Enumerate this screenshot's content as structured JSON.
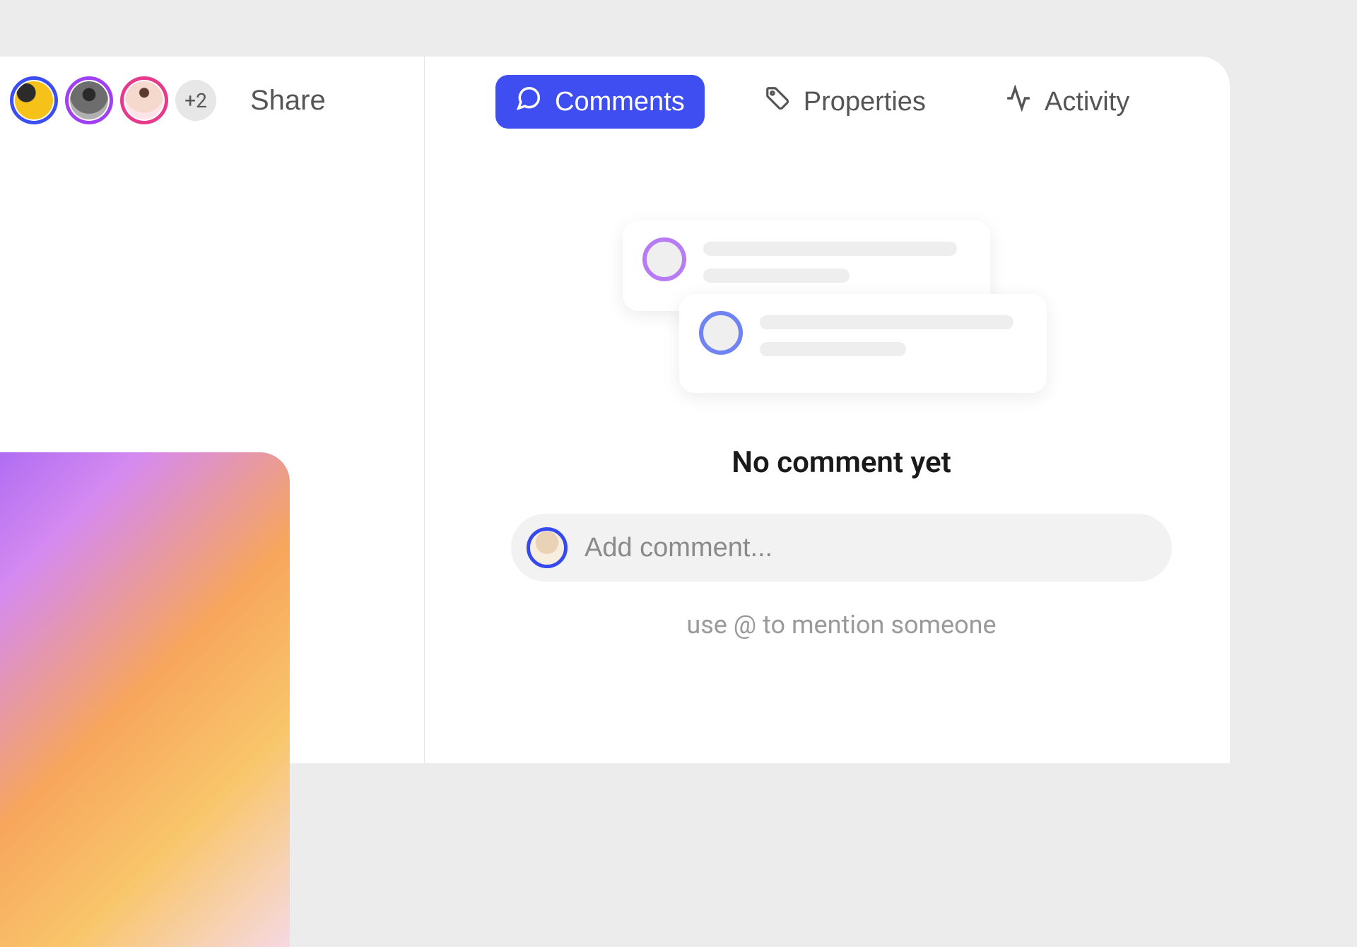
{
  "avatars": {
    "overflow_count": "+2",
    "ring_colors": [
      "#3b4ef4",
      "#a03ff4",
      "#e63b8c"
    ]
  },
  "share_label": "Share",
  "tabs": {
    "comments": "Comments",
    "properties": "Properties",
    "activity": "Activity",
    "active": "comments"
  },
  "empty_state": {
    "title": "No comment yet"
  },
  "comment_box": {
    "placeholder": "Add comment..."
  },
  "hint": "use @ to mention someone",
  "colors": {
    "accent": "#3e4ef0"
  }
}
